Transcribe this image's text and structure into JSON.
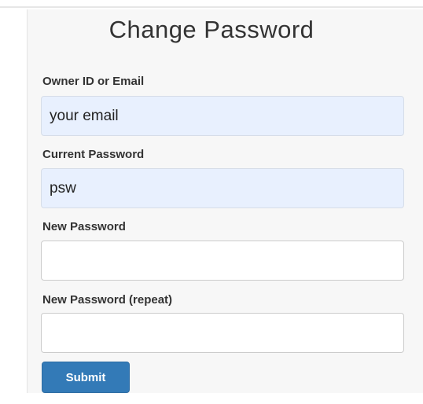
{
  "form": {
    "title": "Change Password",
    "fields": [
      {
        "label": "Owner ID or Email",
        "value": "your email"
      },
      {
        "label": "Current Password",
        "value": "psw"
      },
      {
        "label": "New Password",
        "value": ""
      },
      {
        "label": "New Password (repeat)",
        "value": ""
      }
    ],
    "submit_label": "Submit"
  },
  "colors": {
    "autofill_background": "#e8f0fe",
    "submit_background": "#337ab7",
    "panel_background": "#f7f7f7"
  }
}
